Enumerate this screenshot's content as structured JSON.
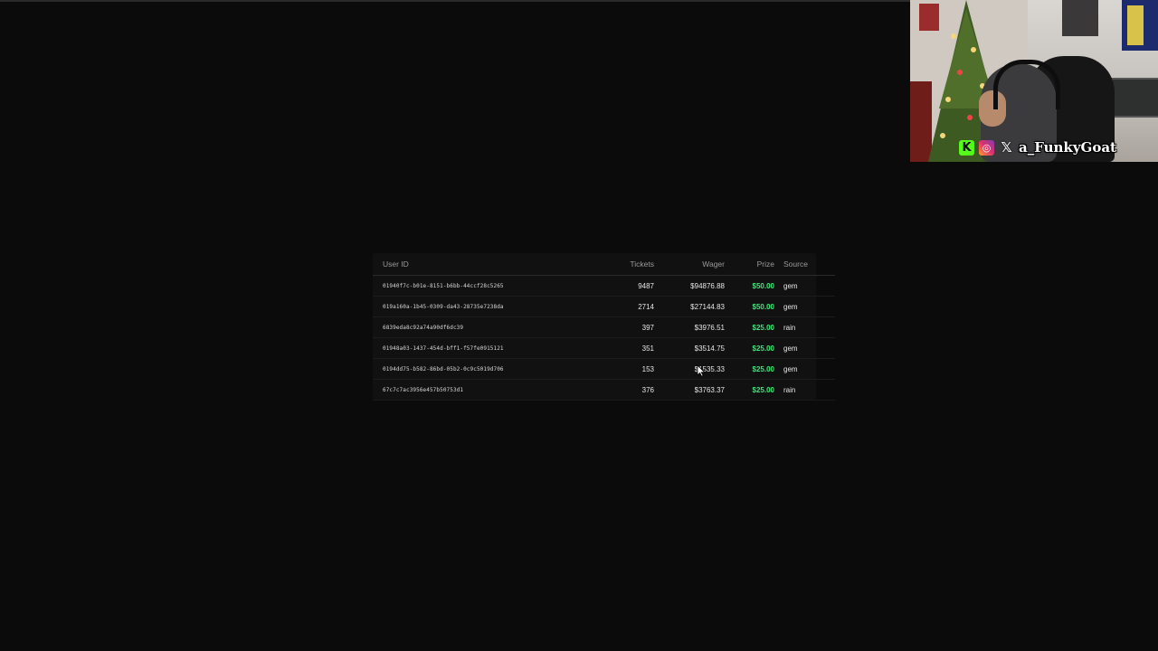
{
  "table": {
    "headers": {
      "user_id": "User ID",
      "tickets": "Tickets",
      "wager": "Wager",
      "prize": "Prize",
      "source": "Source"
    },
    "rows": [
      {
        "user_id": "01940f7c-b01e-8151-b6bb-44ccf28c5265",
        "tickets": "9487",
        "wager": "$94876.88",
        "prize": "$50.00",
        "source": "gem"
      },
      {
        "user_id": "019a160a-1b45-0309-da43-28735e7238da",
        "tickets": "2714",
        "wager": "$27144.83",
        "prize": "$50.00",
        "source": "gem"
      },
      {
        "user_id": "6839eda8c92a74a90df6dc39",
        "tickets": "397",
        "wager": "$3976.51",
        "prize": "$25.00",
        "source": "rain"
      },
      {
        "user_id": "01948a03-1437-454d-bff1-f57fe0915121",
        "tickets": "351",
        "wager": "$3514.75",
        "prize": "$25.00",
        "source": "gem"
      },
      {
        "user_id": "0194dd75-b582-86bd-05b2-0c9c5019d706",
        "tickets": "153",
        "wager": "$1535.33",
        "prize": "$25.00",
        "source": "gem"
      },
      {
        "user_id": "67c7c7ac3956e457b50753d1",
        "tickets": "376",
        "wager": "$3763.37",
        "prize": "$25.00",
        "source": "rain"
      }
    ]
  },
  "webcam": {
    "handle": "a_FunkyGoat",
    "icons": [
      "kick-icon",
      "instagram-icon",
      "x-icon"
    ]
  },
  "colors": {
    "background": "#0b0b0b",
    "panel": "#111111",
    "prize": "#3ee67a",
    "kick": "#53fc18"
  }
}
